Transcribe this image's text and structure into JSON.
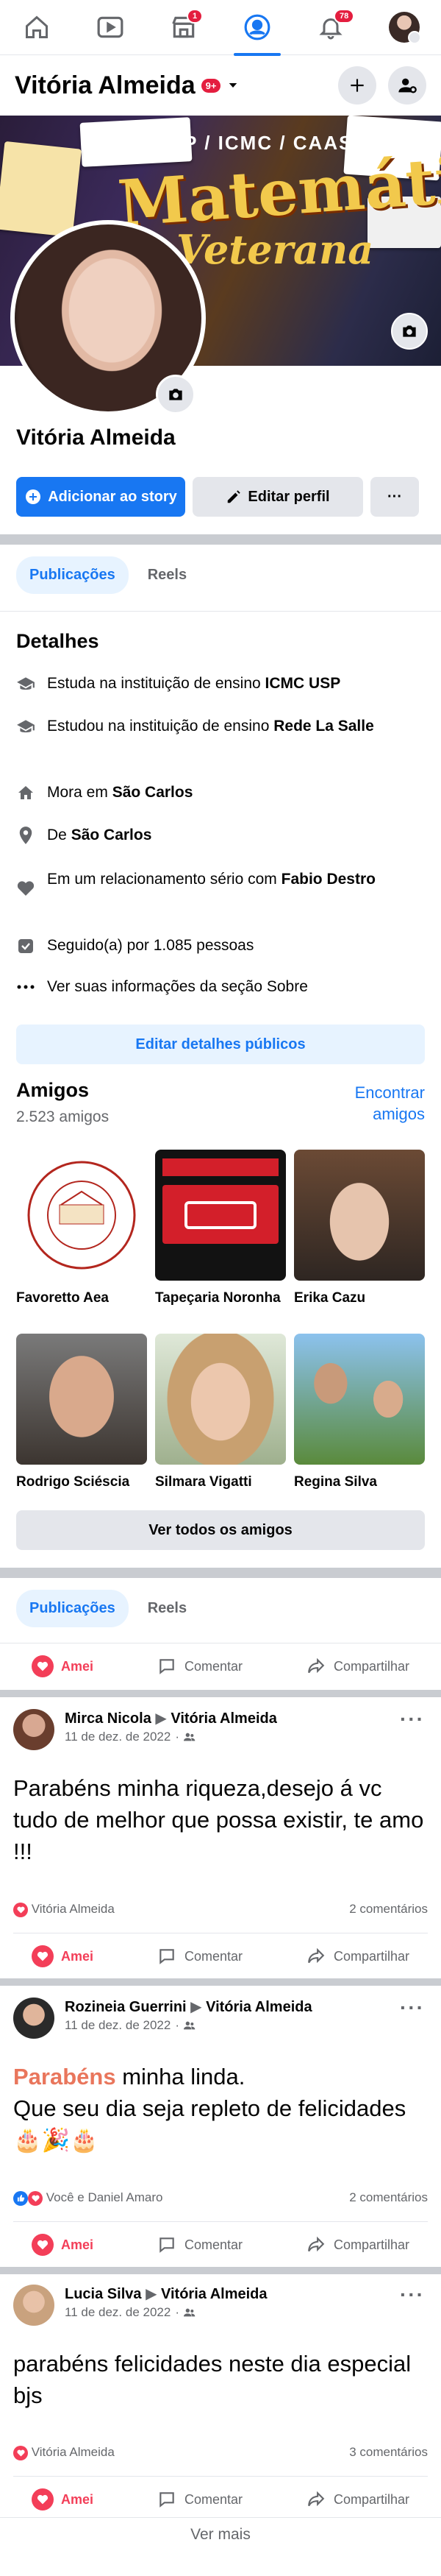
{
  "nav": {
    "notifications_badge": "1",
    "alerts_badge": "78"
  },
  "profile": {
    "name": "Vitória Almeida",
    "badge": "9+",
    "display_name": "Vitória Almeida",
    "add_story_label": "Adicionar ao story",
    "edit_profile_label": "Editar perfil",
    "more_label": "···"
  },
  "cover": {
    "header": "USP / ICMC / CAASO",
    "title": "Matemática",
    "subtitle": "Veterana"
  },
  "tabs": {
    "posts": "Publicações",
    "reels": "Reels"
  },
  "details": {
    "title": "Detalhes",
    "items": [
      {
        "prefix": "Estuda na instituição de ensino ",
        "bold": "ICMC USP",
        "suffix": ""
      },
      {
        "prefix": "Estudou na instituição de ensino ",
        "bold": "Rede La Salle",
        "suffix": ""
      },
      {
        "prefix": "Mora em ",
        "bold": "São Carlos",
        "suffix": ""
      },
      {
        "prefix": "De ",
        "bold": "São Carlos",
        "suffix": ""
      },
      {
        "prefix": "Em um relacionamento sério com ",
        "bold": "Fabio Destro",
        "suffix": ""
      },
      {
        "prefix": "Seguido(a) por 1.085 pessoas",
        "bold": "",
        "suffix": ""
      },
      {
        "prefix": "Ver suas informações da seção Sobre",
        "bold": "",
        "suffix": ""
      }
    ],
    "edit_public_label": "Editar detalhes públicos"
  },
  "friends": {
    "title": "Amigos",
    "count": "2.523 amigos",
    "find_label": "Encontrar amigos",
    "all_label": "Ver todos os amigos",
    "list": [
      {
        "name": "Favoretto Aea"
      },
      {
        "name": "Tapeçaria Noronha"
      },
      {
        "name": "Erika Cazu"
      },
      {
        "name": "Rodrigo Sciéscia"
      },
      {
        "name": "Silmara Vigatti"
      },
      {
        "name": "Regina Silva"
      }
    ]
  },
  "actions": {
    "love": "Amei",
    "comment": "Comentar",
    "share": "Compartilhar"
  },
  "posts": [
    {
      "author": "Mirca Nicola",
      "target": "Vitória Almeida",
      "date": "11 de dez. de 2022",
      "text": "Parabéns minha riqueza,desejo á vc tudo de melhor que possa existir, te amo !!!",
      "reactions": "Vitória Almeida",
      "comments": "2 comentários"
    },
    {
      "author": "Rozineia Guerrini",
      "target": "Vitória Almeida",
      "date": "11 de dez. de 2022",
      "highlight": "Parabéns",
      "text": " minha linda.\nQue seu dia seja repleto de felicidades 🎂🎉🎂",
      "reactions": "Você e Daniel Amaro",
      "comments": "2 comentários"
    },
    {
      "author": "Lucia Silva",
      "target": "Vitória Almeida",
      "date": "11 de dez. de 2022",
      "text": "parabéns felicidades neste dia especial bjs",
      "reactions": "Vitória Almeida",
      "comments": "3 comentários"
    }
  ],
  "footer": {
    "see_more": "Ver mais"
  },
  "colors": {
    "accent": "#1877f2",
    "love": "#f33e58",
    "badge": "#e41e3f",
    "highlight": "#e9765c"
  }
}
